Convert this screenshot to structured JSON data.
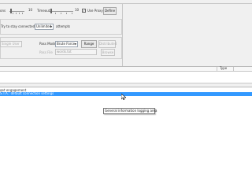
{
  "settings": {
    "threads_value": "10",
    "timeout_label": "Timeout",
    "timeout_value": "10",
    "use_proxy_label": "Use Proxy",
    "use_proxy_checked": true,
    "define_button": "Define",
    "connection_prefix": "Try to stay connected for",
    "connection_select": "Unlimited",
    "connection_suffix": "attempts",
    "single_user_label": "Single User",
    "pass_mode_label": "Pass Mode",
    "pass_mode_value": "Brute Force",
    "range_button": "Range",
    "distributed_button": "Distributed",
    "pass_file_label": "Pass File",
    "pass_file_value": "words.txt",
    "browse_button": "Browse"
  },
  "results_table": {
    "columns": [
      "",
      "Type",
      ""
    ]
  },
  "log": {
    "lines": [
      "get engagement",
      "S.T.A.: default connection settings"
    ],
    "tooltip": "General information logging area"
  }
}
